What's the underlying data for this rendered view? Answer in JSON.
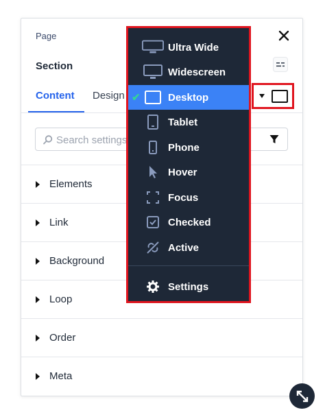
{
  "panel": {
    "breadcrumb": "Page",
    "title": "Section",
    "tabs": [
      {
        "label": "Content",
        "active": true
      },
      {
        "label": "Design",
        "active": false
      }
    ],
    "search": {
      "placeholder": "Search settings",
      "value": ""
    },
    "groups": [
      {
        "label": "Elements"
      },
      {
        "label": "Link"
      },
      {
        "label": "Background"
      },
      {
        "label": "Loop"
      },
      {
        "label": "Order"
      },
      {
        "label": "Meta"
      }
    ]
  },
  "device_menu": {
    "items": [
      {
        "label": "Ultra Wide",
        "icon": "ultra-wide-monitor-icon",
        "selected": false
      },
      {
        "label": "Widescreen",
        "icon": "widescreen-monitor-icon",
        "selected": false
      },
      {
        "label": "Desktop",
        "icon": "desktop-icon",
        "selected": true
      },
      {
        "label": "Tablet",
        "icon": "tablet-icon",
        "selected": false
      },
      {
        "label": "Phone",
        "icon": "phone-icon",
        "selected": false
      },
      {
        "label": "Hover",
        "icon": "cursor-icon",
        "selected": false
      },
      {
        "label": "Focus",
        "icon": "focus-icon",
        "selected": false
      },
      {
        "label": "Checked",
        "icon": "checkbox-icon",
        "selected": false
      },
      {
        "label": "Active",
        "icon": "active-link-icon",
        "selected": false
      }
    ],
    "settings_label": "Settings"
  },
  "colors": {
    "accent": "#2563eb",
    "menu_bg": "#1e2837",
    "selected_bg": "#3b82f6",
    "check": "#34d399",
    "highlight_outline": "#e0141e"
  }
}
